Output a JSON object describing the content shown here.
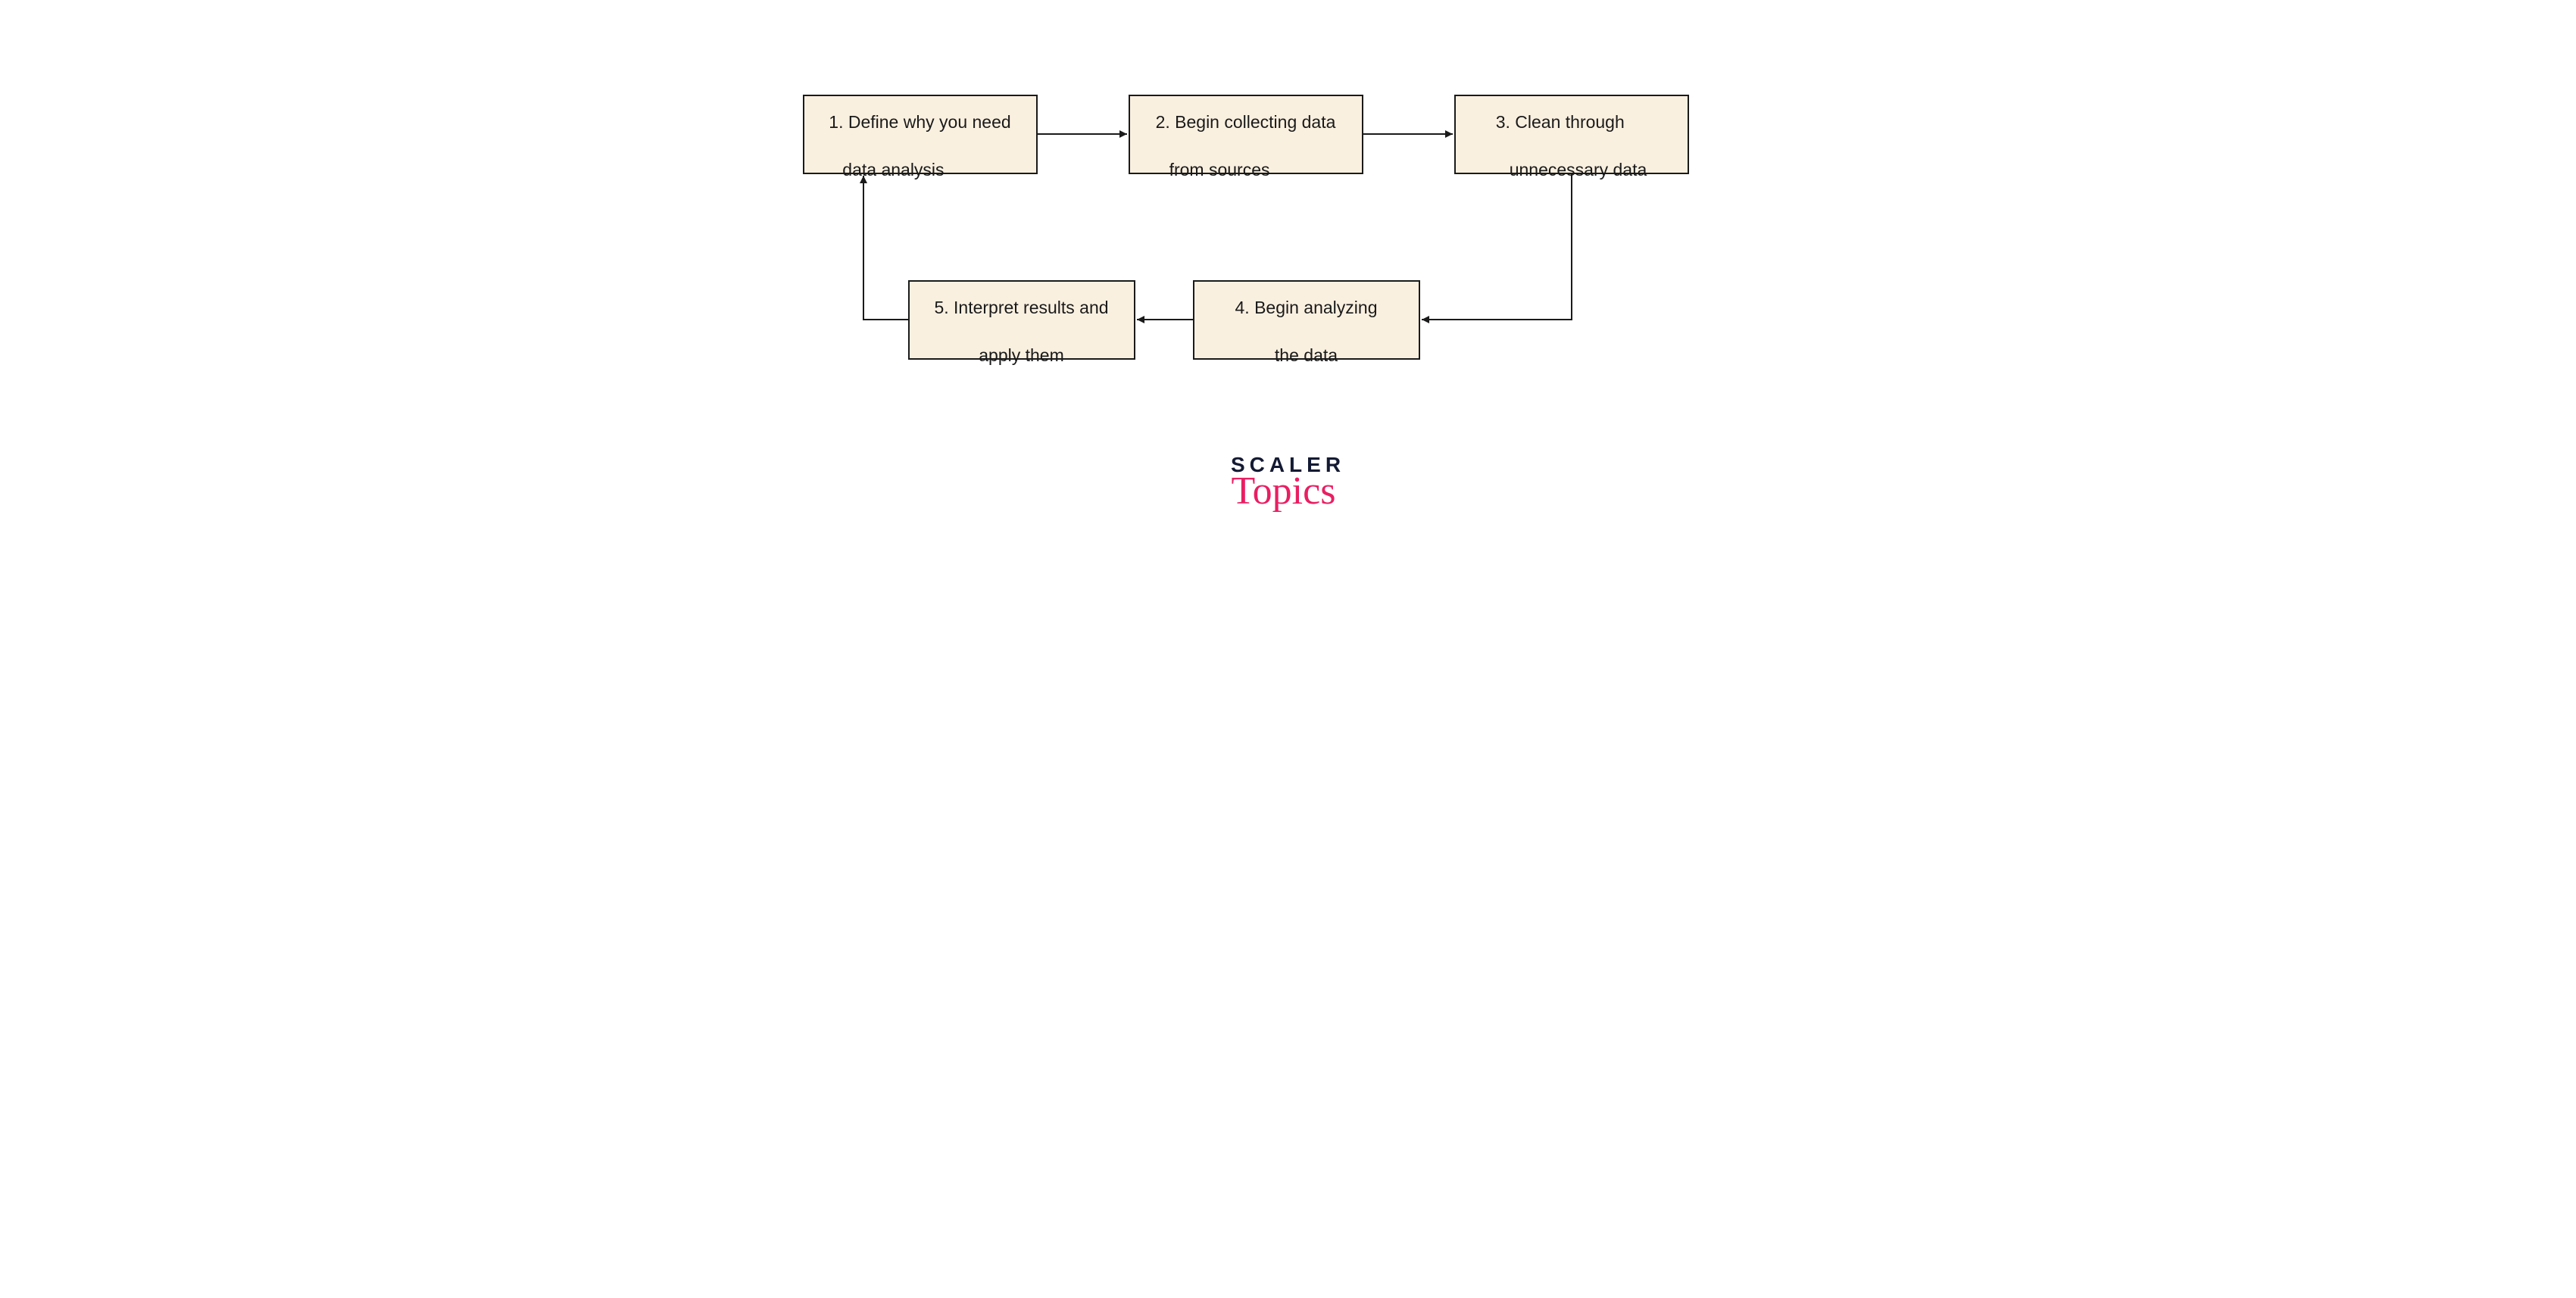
{
  "diagram": {
    "nodes": {
      "step1": {
        "line1": "1. Define why you need",
        "line2": "data analysis"
      },
      "step2": {
        "line1": "2. Begin collecting data",
        "line2": "from sources"
      },
      "step3": {
        "line1": "3. Clean through",
        "line2": "unnecessary data"
      },
      "step4": {
        "line1": "4. Begin analyzing",
        "line2": "the data"
      },
      "step5": {
        "line1": "5. Interpret results and",
        "line2": "apply them"
      }
    },
    "edges": [
      {
        "from": "step1",
        "to": "step2"
      },
      {
        "from": "step2",
        "to": "step3"
      },
      {
        "from": "step3",
        "to": "step4"
      },
      {
        "from": "step4",
        "to": "step5"
      },
      {
        "from": "step5",
        "to": "step1"
      }
    ],
    "colors": {
      "node_fill": "#faf0e0",
      "node_border": "#1a1a1a",
      "arrow": "#1a1a1a",
      "brand_dark": "#141a33",
      "brand_accent": "#e91e63"
    }
  },
  "brand": {
    "line1": "SCALER",
    "line2": "Topics"
  }
}
